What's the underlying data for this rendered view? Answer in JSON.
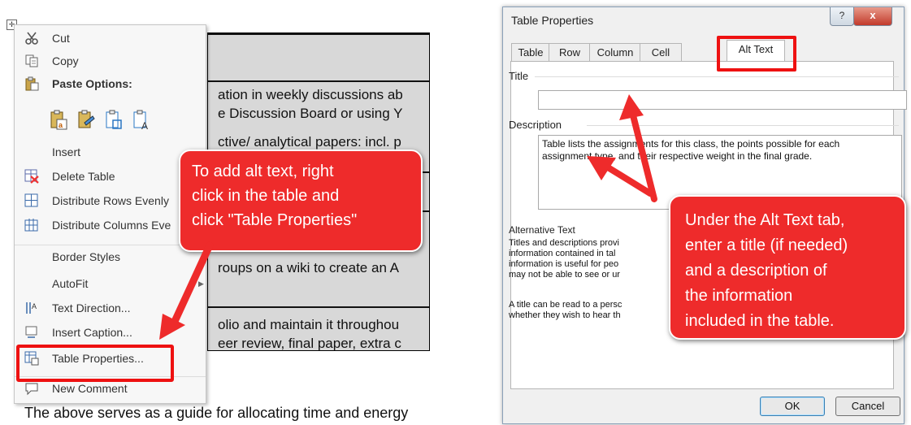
{
  "left": {
    "doc_lines": [
      "ation in weekly discussions ab",
      "e Discussion Board or using Y",
      "ctive/ analytical papers: incl. p",
      "roups on a wiki to create an A",
      "olio and maintain it throughou",
      "eer review, final paper, extra c"
    ],
    "doc_bottom": "The above serves as a guide for allocating time and energy",
    "context_menu": {
      "cut": "Cut",
      "copy": "Copy",
      "paste_options": "Paste Options:",
      "insert": "Insert",
      "delete_table": "Delete Table",
      "distribute_rows": "Distribute Rows Evenly",
      "distribute_columns": "Distribute Columns Eve",
      "border_styles": "Border Styles",
      "autofit": "AutoFit",
      "text_direction": "Text Direction...",
      "insert_caption": "Insert Caption...",
      "table_properties": "Table Properties...",
      "new_comment": "New Comment"
    },
    "callout": {
      "line1": "To add alt text, right",
      "line2": "click in the table and",
      "line3": "click \"Table Properties\""
    }
  },
  "dialog": {
    "title": "Table Properties",
    "tabs": [
      "Table",
      "Row",
      "Column",
      "Cell",
      "Alt Text"
    ],
    "title_label": "Title",
    "title_value": "",
    "description_label": "Description",
    "description_value_1": "Table lists the assignments for this class, the points possible for each",
    "description_value_2": "assignment type, and their respective weight in the final grade.",
    "alt_heading": "Alternative Text",
    "alt_lines": [
      "Titles and descriptions provi",
      "information contained in tal",
      "information is useful for peo",
      "may not be able to see or ur",
      "",
      "A title can be read to a persc",
      "whether they wish to hear th"
    ],
    "ok": "OK",
    "cancel": "Cancel",
    "help_btn": "?",
    "close_btn": "x"
  },
  "callout_right": {
    "line1": "Under the Alt Text tab,",
    "line2": "enter a title (if needed)",
    "line3": "and a description of",
    "line4": "the information",
    "line5": "included in the table."
  },
  "colors": {
    "callout": "#ee2b2b",
    "highlight": "#e11111",
    "dialog_bg": "#f0f0f0"
  }
}
